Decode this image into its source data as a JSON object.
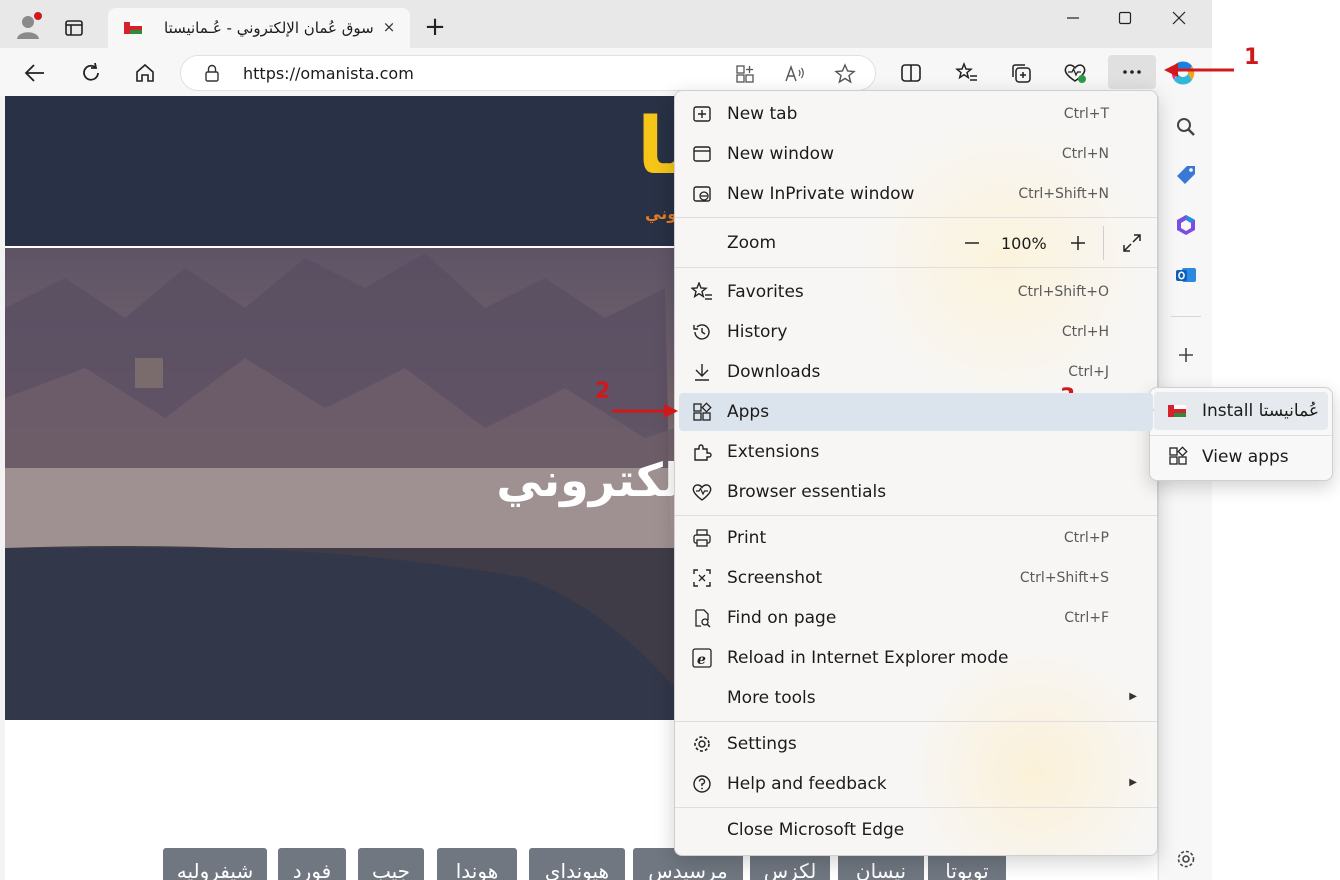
{
  "tab": {
    "title": "سوق عُمان الإلكتروني - عُـمانيستا",
    "close": "×"
  },
  "window": {
    "new_tab_symbol": "+"
  },
  "address": {
    "url": "https://omanista.com"
  },
  "site": {
    "logo_text": "تا",
    "tagline": "وني",
    "hero_title": "عُمان الإلكتروني",
    "brands": [
      "شيفروليه",
      "فورد",
      "جيب",
      "هوندا",
      "هيونداي",
      "مرسيدس",
      "لكزس",
      "نيسان",
      "تويوتا"
    ]
  },
  "menu": {
    "items": [
      {
        "label": "New tab",
        "shortcut": "Ctrl+T",
        "icon": "new-tab-icon"
      },
      {
        "label": "New window",
        "shortcut": "Ctrl+N",
        "icon": "new-window-icon"
      },
      {
        "label": "New InPrivate window",
        "shortcut": "Ctrl+Shift+N",
        "icon": "inprivate-icon"
      },
      {
        "label": "Favorites",
        "shortcut": "Ctrl+Shift+O",
        "icon": "favorites-icon"
      },
      {
        "label": "History",
        "shortcut": "Ctrl+H",
        "icon": "history-icon"
      },
      {
        "label": "Downloads",
        "shortcut": "Ctrl+J",
        "icon": "downloads-icon"
      },
      {
        "label": "Apps",
        "shortcut": "",
        "icon": "apps-icon"
      },
      {
        "label": "Extensions",
        "shortcut": "",
        "icon": "extensions-icon"
      },
      {
        "label": "Browser essentials",
        "shortcut": "",
        "icon": "heart-pulse-icon"
      },
      {
        "label": "Print",
        "shortcut": "Ctrl+P",
        "icon": "print-icon"
      },
      {
        "label": "Screenshot",
        "shortcut": "Ctrl+Shift+S",
        "icon": "screenshot-icon"
      },
      {
        "label": "Find on page",
        "shortcut": "Ctrl+F",
        "icon": "find-icon"
      },
      {
        "label": "Reload in Internet Explorer mode",
        "shortcut": "",
        "icon": "ie-icon"
      },
      {
        "label": "More tools",
        "shortcut": "",
        "icon": ""
      },
      {
        "label": "Settings",
        "shortcut": "",
        "icon": "gear-icon"
      },
      {
        "label": "Help and feedback",
        "shortcut": "",
        "icon": "help-icon"
      },
      {
        "label": "Close Microsoft Edge",
        "shortcut": "",
        "icon": ""
      }
    ],
    "zoom": {
      "label": "Zoom",
      "value": "100%",
      "minus": "—",
      "plus": "+"
    }
  },
  "submenu": {
    "install_label": "Install عُمانيستا",
    "view_apps_label": "View apps"
  },
  "annotations": {
    "one": "1",
    "two": "2",
    "three": "3"
  },
  "colors": {
    "accent": "#d0191d",
    "highlight": "#dbe3ec",
    "site_header": "#283145",
    "logo": "#f5c518"
  }
}
